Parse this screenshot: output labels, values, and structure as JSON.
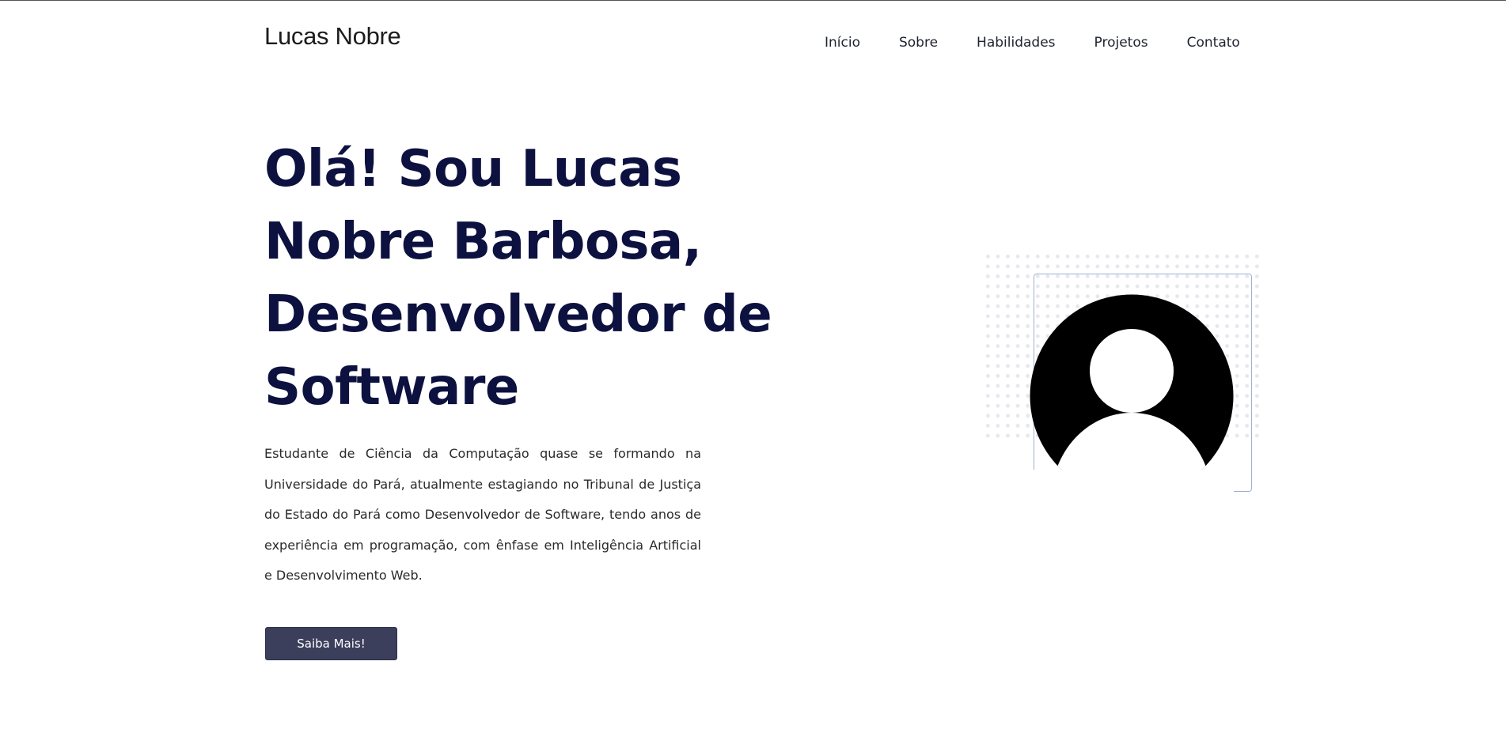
{
  "header": {
    "logo": "Lucas Nobre",
    "nav": [
      "Início",
      "Sobre",
      "Habilidades",
      "Projetos",
      "Contato"
    ]
  },
  "hero": {
    "title": "Olá! Sou Lucas Nobre Barbosa, Desenvolvedor de Software",
    "description": "Estudante de Ciência da Computação quase se formando na Universidade do Pará, atualmente estagiando no Tribunal de Justiça do Estado do Pará como Desenvolvedor de Software, tendo anos de experiência em programação, com ênfase em Inteligência Artificial e Desenvolvimento Web.",
    "cta_label": "Saiba Mais!"
  },
  "colors": {
    "title": "#0d1140",
    "button_bg": "#3c3f5c",
    "frame_border": "#9fb0d2"
  },
  "icons": {
    "avatar": "user-avatar-icon"
  }
}
